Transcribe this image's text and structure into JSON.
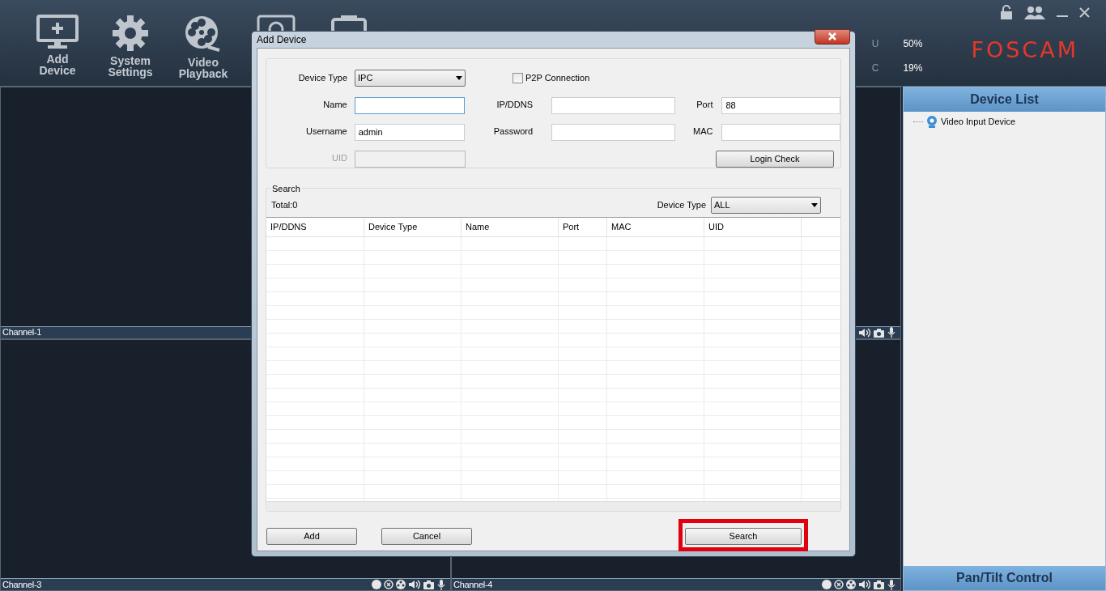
{
  "toolbar": [
    {
      "kind": "add",
      "label": "Add Device"
    },
    {
      "kind": "settings",
      "label": "System Settings"
    },
    {
      "kind": "playback",
      "label": "Video Playback"
    },
    {
      "kind": "record"
    },
    {
      "kind": "clipboard"
    }
  ],
  "stats": [
    {
      "label": "U",
      "value": "50%"
    },
    {
      "label": "C",
      "value": "19%"
    }
  ],
  "logo": "FOSCAM",
  "channels": [
    {
      "kind": "plain",
      "label": "Channel-1"
    },
    {
      "kind": "partial"
    },
    {
      "kind": "full",
      "label": "Channel-3"
    },
    {
      "kind": "full",
      "label": "Channel-4"
    }
  ],
  "device_list": {
    "title": "Device List",
    "items": [
      {
        "label": "Video Input Device"
      }
    ]
  },
  "pan_tilt": {
    "title": "Pan/Tilt Control"
  },
  "dialog": {
    "title": "Add Device",
    "device_type": {
      "label": "Device Type",
      "value": "IPC"
    },
    "p2p": {
      "label": "P2P Connection",
      "checked": false
    },
    "fields": [
      {
        "label": "Name",
        "focused": true,
        "disabled": false
      },
      {
        "label": "IP/DDNS",
        "focused": false,
        "disabled": false
      },
      {
        "label": "Port",
        "value": "88",
        "focused": false,
        "disabled": false
      },
      {
        "label": "Username",
        "value": "admin",
        "focused": false,
        "disabled": false
      },
      {
        "label": "Password",
        "focused": false,
        "disabled": false
      },
      {
        "label": "MAC",
        "focused": false,
        "disabled": false
      },
      {
        "label": "UID",
        "disabled": true
      }
    ],
    "login_check": "Login Check",
    "search_group": "Search",
    "total": "Total:0",
    "filter": {
      "label": "Device Type",
      "value": "ALL"
    },
    "columns": [
      "IP/DDNS",
      "Device Type",
      "Name",
      "Port",
      "MAC",
      "UID"
    ],
    "buttons": [
      {
        "label": "Add",
        "highlighted": false
      },
      {
        "label": "Cancel",
        "highlighted": false
      },
      {
        "label": "Search",
        "highlighted": true
      }
    ]
  }
}
